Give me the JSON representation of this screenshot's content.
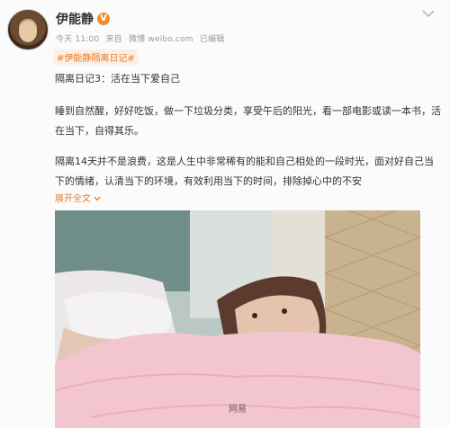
{
  "post": {
    "username": "伊能静",
    "verified_badge": "V",
    "time": "今天 11:00",
    "source_prefix": "来自",
    "source": "微博 weibo.com",
    "edited": "已编辑",
    "hashtag": "#伊能静隔离日记#",
    "title": "隔离日记3：活在当下爱自己",
    "paragraph1": "睡到自然醒，好好吃饭，做一下垃圾分类，享受午后的阳光，看一部电影或读一本书，活在当下，自得其乐。",
    "paragraph2": "隔离14天并不是浪费，这是人生中非常稀有的能和自己相处的一段时光，面对好自己当下的情绪，认清当下的环境，有效利用当下的时间，排除掉心中的不安",
    "expand_label": "展开全文",
    "expand_icon": "chevron-down-icon"
  },
  "photo": {
    "caption": "网易"
  },
  "colors": {
    "accent": "#e87c28",
    "text": "#333333",
    "meta": "#999999"
  }
}
